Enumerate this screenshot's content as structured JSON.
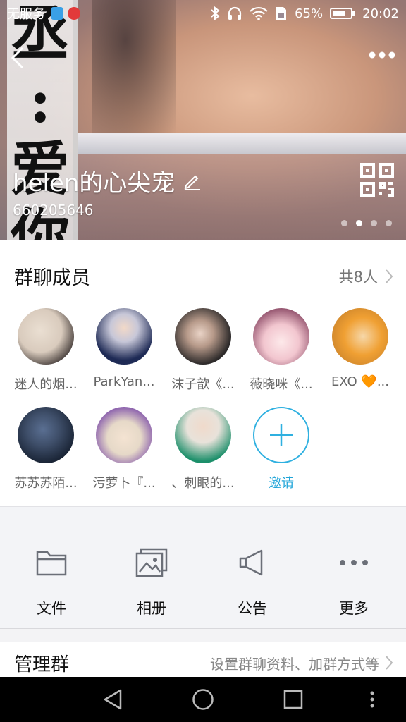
{
  "status_bar": {
    "carrier": "无服务",
    "battery": "65%",
    "time": "20:02"
  },
  "cover": {
    "sticker_chars": [
      "丞",
      ":",
      "爱",
      "你"
    ],
    "group_name": "helen的心尖宠",
    "group_id": "660205646",
    "page_dots": 4,
    "active_dot": 2
  },
  "members": {
    "title": "群聊成员",
    "count": "共8人",
    "list": [
      {
        "name": "迷人的烟...",
        "colors": [
          "#d9cbbd",
          "#3a3230"
        ]
      },
      {
        "name": "ParkYan...",
        "colors": [
          "#1e2a55",
          "#c7c7d8"
        ]
      },
      {
        "name": "沫子歆《...",
        "colors": [
          "#2d2a2a",
          "#b79a8a"
        ]
      },
      {
        "name": "薇晓咪《...",
        "colors": [
          "#f2c6cf",
          "#8c4a66"
        ]
      },
      {
        "name": "EXO 🧡...",
        "colors": [
          "#f0a033",
          "#e0c070"
        ]
      },
      {
        "name": "苏苏苏陌...",
        "colors": [
          "#182233",
          "#3f4f6a"
        ]
      },
      {
        "name": "污萝卜『...",
        "colors": [
          "#e6d9c8",
          "#7a4aa8"
        ]
      },
      {
        "name": "、刺眼的...",
        "colors": [
          "#e8e2da",
          "#1c8f6a"
        ]
      }
    ],
    "invite_label": "邀请"
  },
  "tools": [
    {
      "label": "文件",
      "icon": "folder-icon"
    },
    {
      "label": "相册",
      "icon": "album-icon"
    },
    {
      "label": "公告",
      "icon": "announcement-icon"
    },
    {
      "label": "更多",
      "icon": "more-dots-icon"
    }
  ],
  "manage": {
    "title": "管理群",
    "desc": "设置群聊资料、加群方式等"
  },
  "colors": {
    "accent": "#1fa4d8",
    "icon_gray": "#6b6f78"
  }
}
